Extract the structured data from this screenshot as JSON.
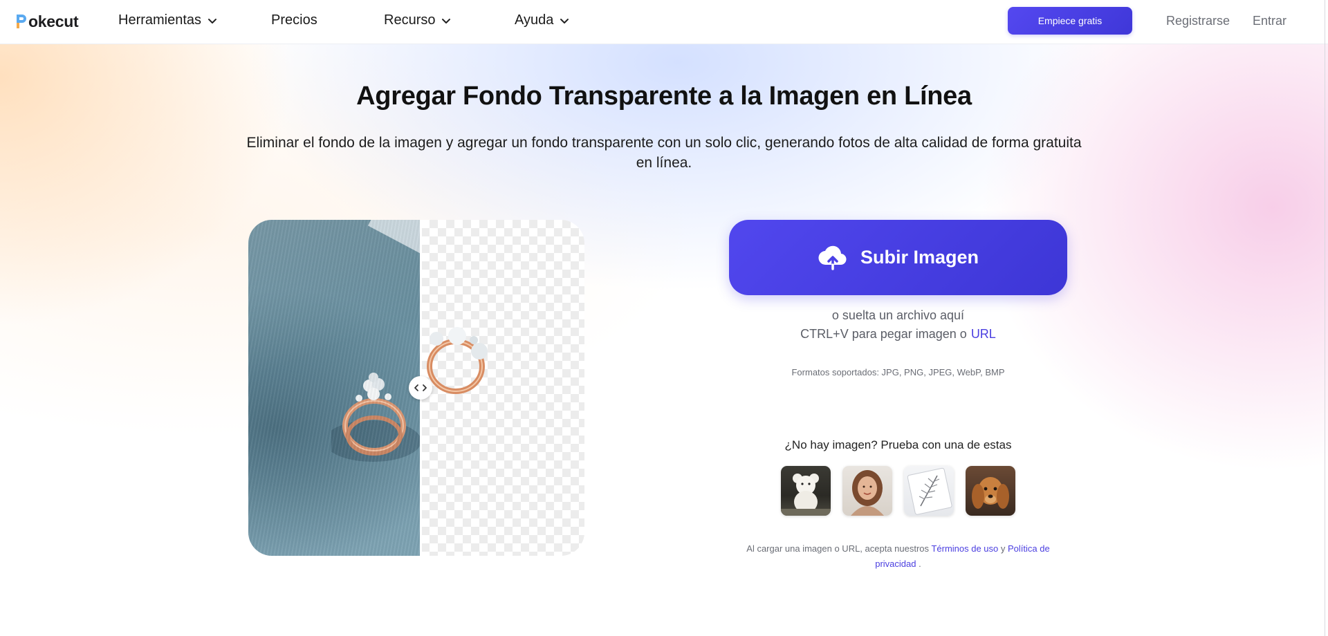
{
  "header": {
    "logo_text": "okecut",
    "nav": [
      {
        "label": "Herramientas",
        "has_dropdown": true
      },
      {
        "label": "Precios",
        "has_dropdown": false
      },
      {
        "label": "Recurso",
        "has_dropdown": true
      },
      {
        "label": "Ayuda",
        "has_dropdown": true
      }
    ],
    "cta_label": "Empiece gratis",
    "register_label": "Registrarse",
    "login_label": "Entrar"
  },
  "hero": {
    "title": "Agregar Fondo Transparente a la Imagen en Línea",
    "subtitle": "Eliminar el fondo de la imagen y agregar un fondo transparente con un solo clic, generando fotos de alta calidad de forma gratuita en línea."
  },
  "upload": {
    "button_label": "Subir Imagen",
    "drop_text": "o suelta un archivo aquí",
    "paste_text": "CTRL+V para pegar imagen o",
    "url_label": "URL",
    "formats_text": "Formatos soportados: JPG, PNG, JPEG, WebP, BMP"
  },
  "samples": {
    "title": "¿No hay imagen? Prueba con una de estas",
    "items": [
      {
        "name": "sample-teddy-bear"
      },
      {
        "name": "sample-woman-portrait"
      },
      {
        "name": "sample-feather-sketch"
      },
      {
        "name": "sample-dog"
      }
    ]
  },
  "legal": {
    "prefix": "Al cargar una imagen o URL, acepta nuestros",
    "terms": "Términos de uso",
    "and": "y",
    "privacy": "Política de privacidad",
    "suffix": "."
  },
  "colors": {
    "accent": "#4a3ee0",
    "button_gradient_start": "#5147ee",
    "button_gradient_end": "#3d36d6"
  },
  "icons": {
    "upload": "cloud-upload-icon",
    "dropdown": "chevron-down-icon",
    "compare_handle": "left-right-arrows-icon"
  }
}
